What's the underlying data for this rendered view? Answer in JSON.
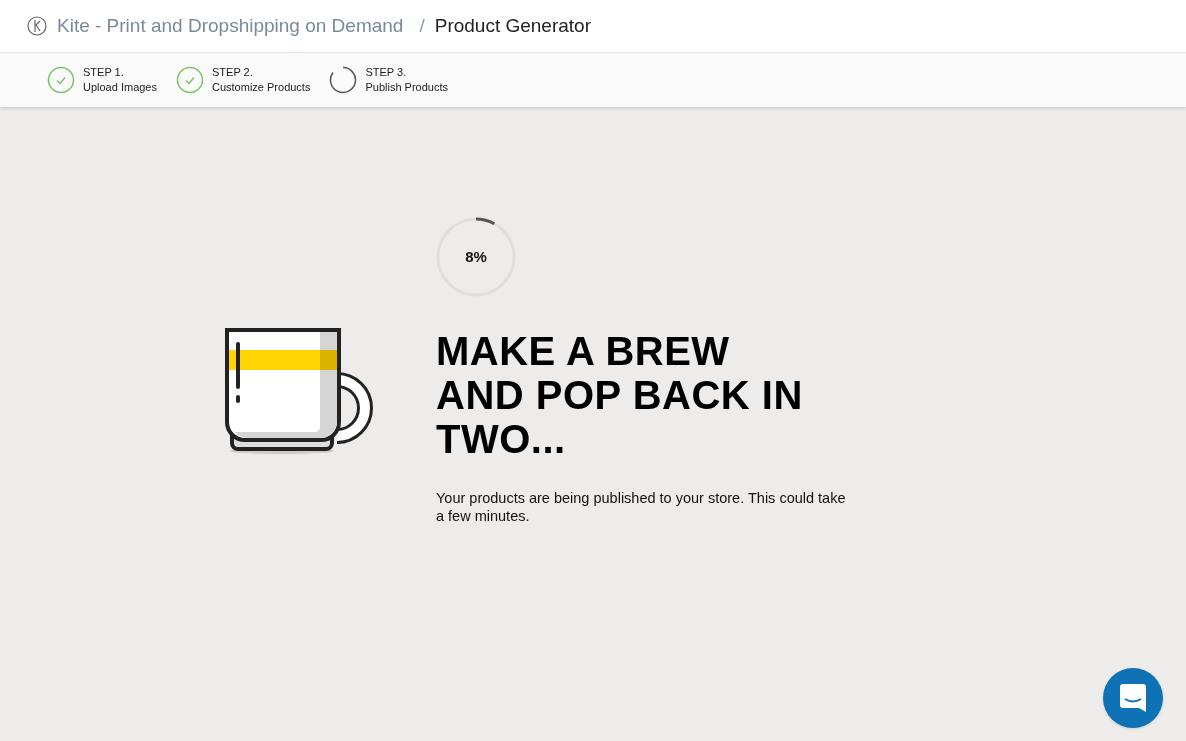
{
  "breadcrumb": {
    "app": "Kite - Print and Dropshipping on Demand",
    "separator": "/",
    "page": "Product Generator"
  },
  "steps": [
    {
      "number": "STEP 1.",
      "label": "Upload Images",
      "completed": true
    },
    {
      "number": "STEP 2.",
      "label": "Customize Products",
      "completed": true
    },
    {
      "number": "STEP 3.",
      "label": "Publish Products",
      "completed": false
    }
  ],
  "progress": {
    "level": 0.08,
    "reading": "8%"
  },
  "heading": "MAKE A BREW AND POP BACK IN TWO...",
  "message": "Your products are being published to your store. This could take a few minutes."
}
